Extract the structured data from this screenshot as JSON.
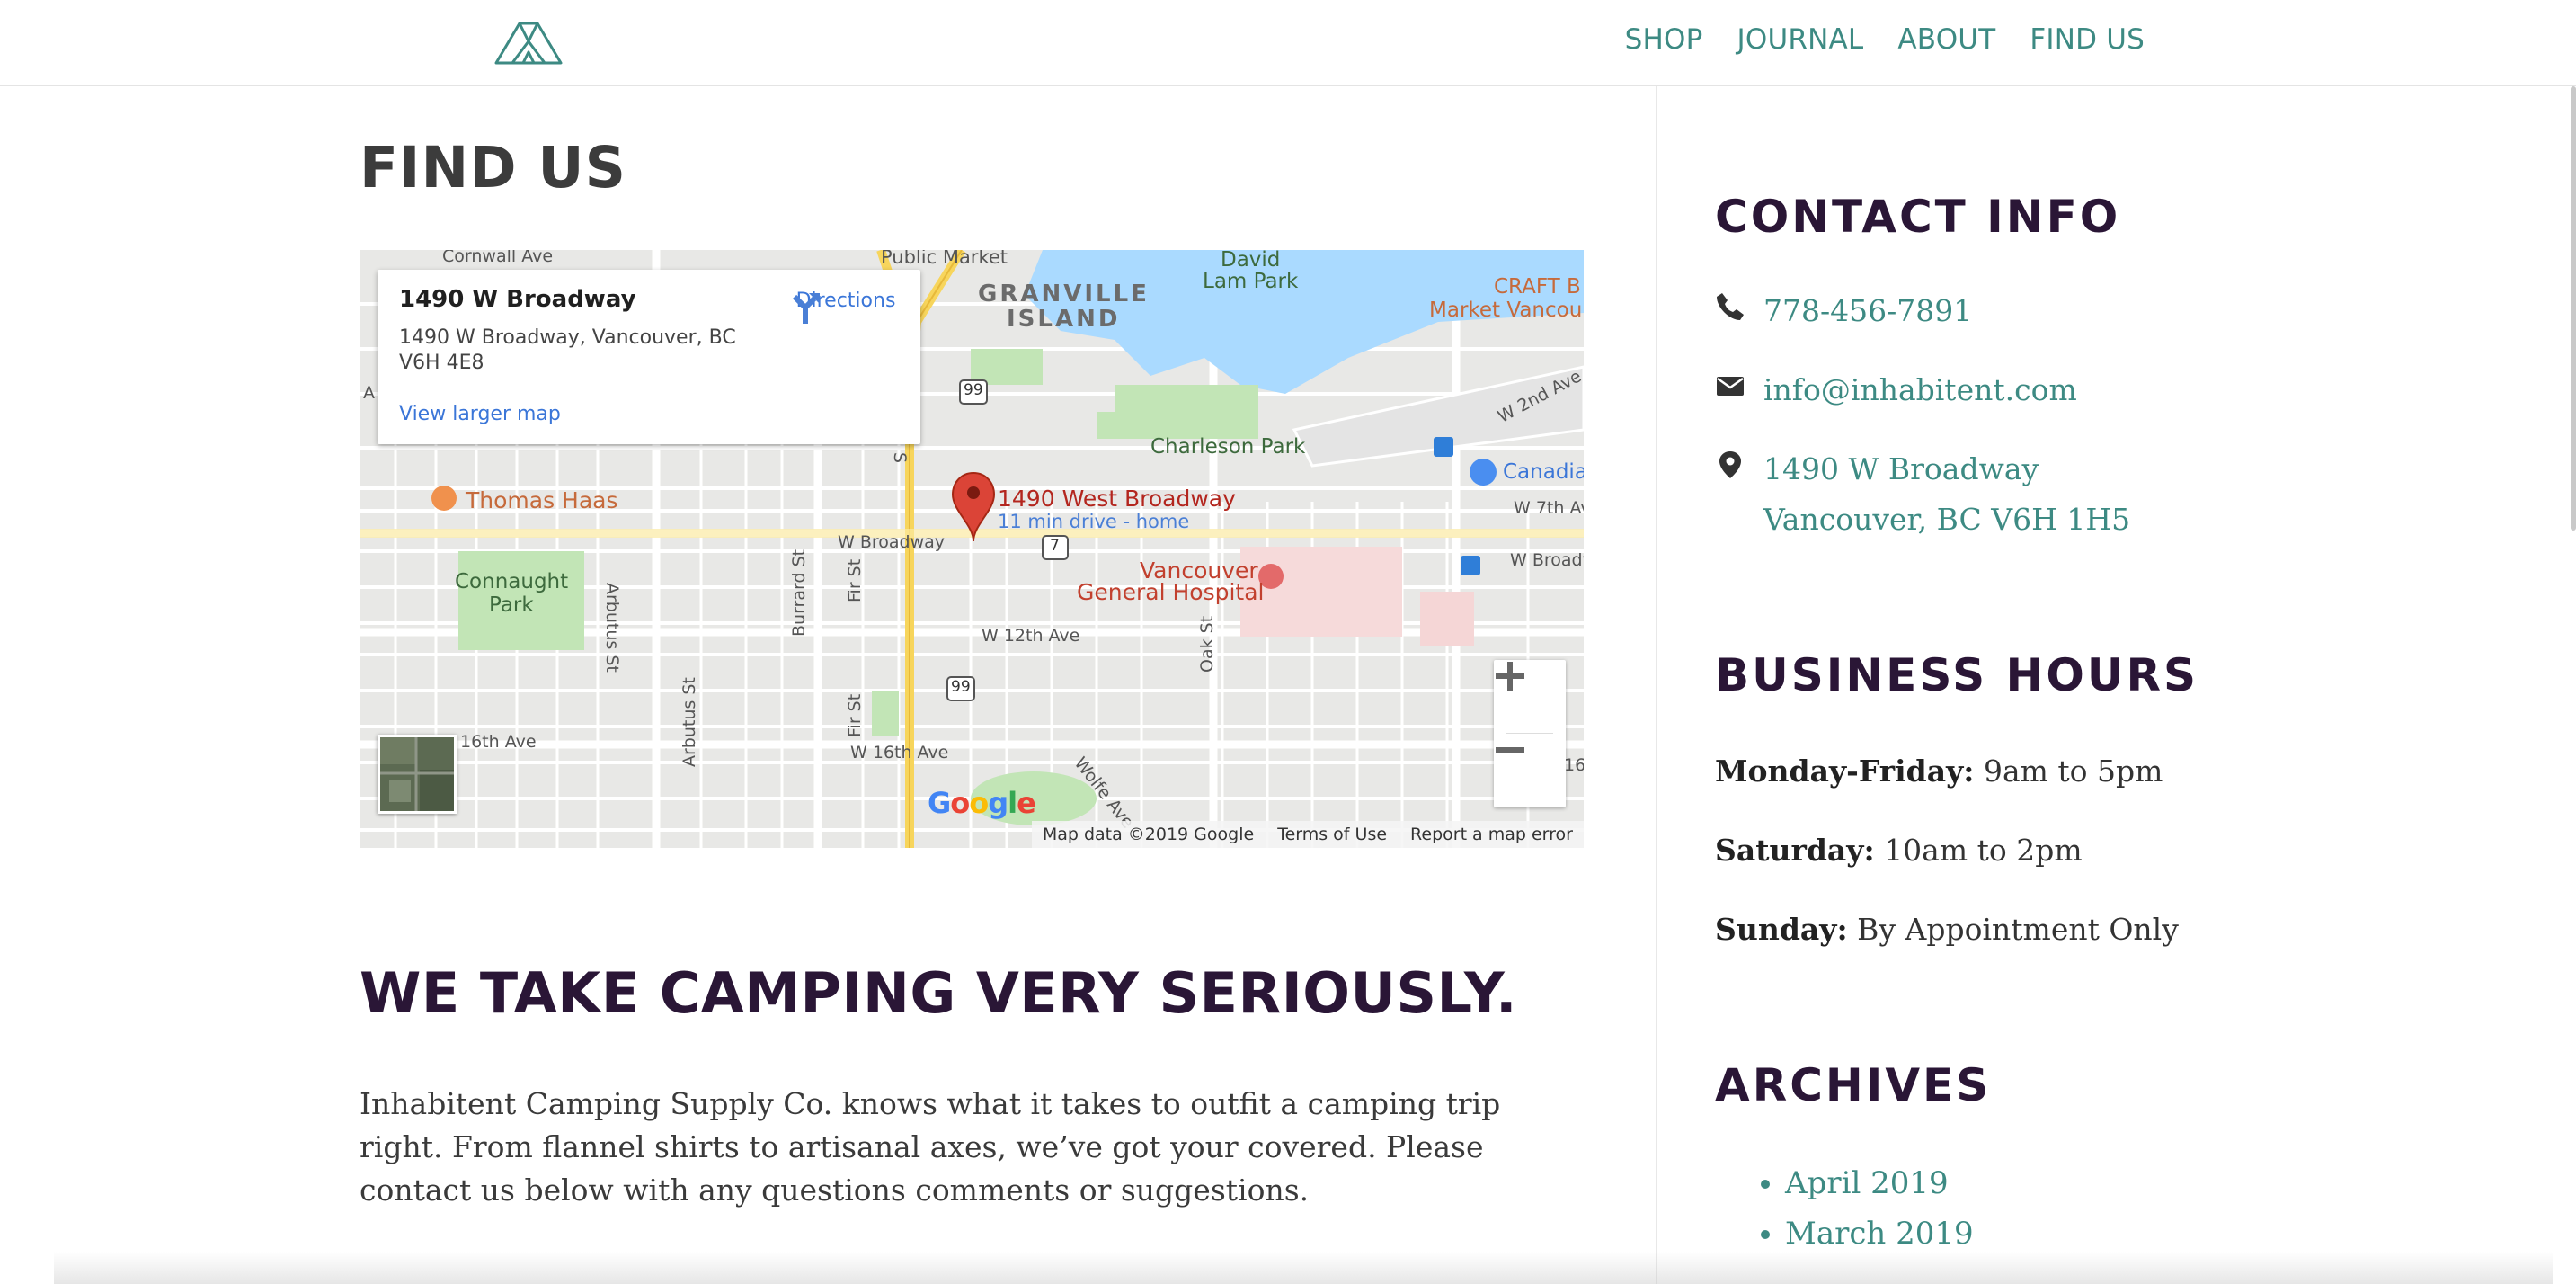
{
  "nav": {
    "items": [
      "SHOP",
      "JOURNAL",
      "ABOUT",
      "FIND US"
    ]
  },
  "page": {
    "title": "FIND US",
    "tagline": "WE TAKE CAMPING VERY SERIOUSLY.",
    "intro": "Inhabitent Camping Supply Co. knows what it takes to outfit a camping trip right. From flannel shirts to artisanal axes, we’ve got your covered. Please contact us below with any questions comments or suggestions."
  },
  "map": {
    "card_title": "1490 W Broadway",
    "card_address": "1490 W Broadway, Vancouver, BC V6H 4E8",
    "directions_label": "Directions",
    "larger_map_link": "View larger map",
    "pin_title": "1490 West Broadway",
    "pin_subtitle": "11 min drive - home",
    "labels": {
      "cornwall": "Cornwall Ave",
      "public_market": "Public Market",
      "granville1": "GRANVILLE",
      "granville2": "ISLAND",
      "david_lam1": "David",
      "david_lam2": "Lam Park",
      "craft1": "CRAFT B",
      "craft2": "Market Vancou",
      "w2nd": "W 2nd Ave",
      "charleson": "Charleson Park",
      "canadian": "Canadia",
      "w7th": "W 7th Av",
      "thomas_haas": "Thomas Haas",
      "wbroadway": "W Broadway",
      "wbroadway2": "W Broadway",
      "connaught1": "Connaught",
      "connaught2": "Park",
      "arbutus": "Arbutus St",
      "arbutus2": "Arbutus St",
      "burrard": "Burrard St",
      "fir": "Fir St",
      "fir2": "Fir St",
      "vgh1": "Vancouver",
      "vgh2": "General Hospital",
      "w12th": "W 12th Ave",
      "oak": "Oak St",
      "w16th": "W 16th Ave",
      "16th": "16th Ave",
      "wolfe": "Wolfe Ave",
      "r99a": "99",
      "r99b": "99",
      "r7": "7",
      "sixteen": "16",
      "a": "A",
      "s": "S"
    },
    "footer": [
      "Map data ©2019 Google",
      "Terms of Use",
      "Report a map error"
    ],
    "google": [
      "G",
      "o",
      "o",
      "g",
      "l",
      "e"
    ],
    "google_colors": [
      "#4285f4",
      "#ea4335",
      "#fbbc05",
      "#4285f4",
      "#34a853",
      "#ea4335"
    ]
  },
  "contact": {
    "heading": "CONTACT INFO",
    "phone": "778-456-7891",
    "email": "info@inhabitent.com",
    "address_line1": "1490 W Broadway",
    "address_line2": "Vancouver, BC V6H 1H5"
  },
  "hours": {
    "heading": "BUSINESS HOURS",
    "rows": [
      {
        "day": "Monday-Friday:",
        "time": "9am to 5pm"
      },
      {
        "day": "Saturday:",
        "time": "10am to 2pm"
      },
      {
        "day": "Sunday:",
        "time": "By Appointment Only"
      }
    ]
  },
  "archives": {
    "heading": "ARCHIVES",
    "items": [
      "April 2019",
      "March 2019"
    ]
  },
  "colors": {
    "accent": "#3d8a83",
    "heading": "#2a1636"
  },
  "icons": [
    "tent-logo-icon",
    "phone-icon",
    "envelope-icon",
    "map-marker-icon",
    "directions-icon",
    "map-pin-icon",
    "zoom-in-icon",
    "zoom-out-icon"
  ]
}
